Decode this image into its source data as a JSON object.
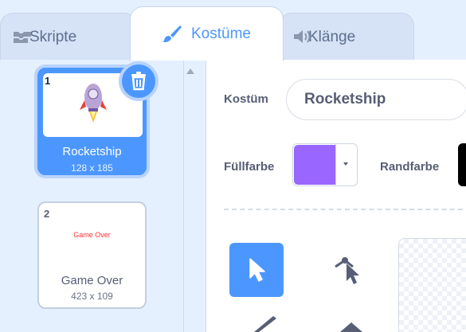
{
  "tabs": {
    "skripte": "Skripte",
    "kostume": "Kostüme",
    "klaenge": "Klänge"
  },
  "costumes": [
    {
      "number": "1",
      "name": "Rocketship",
      "size": "128 x 185",
      "selected": true
    },
    {
      "number": "2",
      "name": "Game Over",
      "size": "423 x 109",
      "selected": false,
      "thumb_text": "Game Over"
    }
  ],
  "editor": {
    "costume_label": "Kostüm",
    "costume_name": "Rocketship",
    "fill_label": "Füllfarbe",
    "fill_color": "#9966ff",
    "outline_label": "Randfarbe",
    "outline_color": "#000000"
  },
  "icons": {
    "skripte": "code-blocks-icon",
    "kostume": "paintbrush-icon",
    "klaenge": "speaker-icon",
    "delete": "trash-icon",
    "select": "arrow-select-icon",
    "reshape": "reshape-icon"
  },
  "colors": {
    "accent": "#4c97ff",
    "background": "#e5f0ff"
  }
}
